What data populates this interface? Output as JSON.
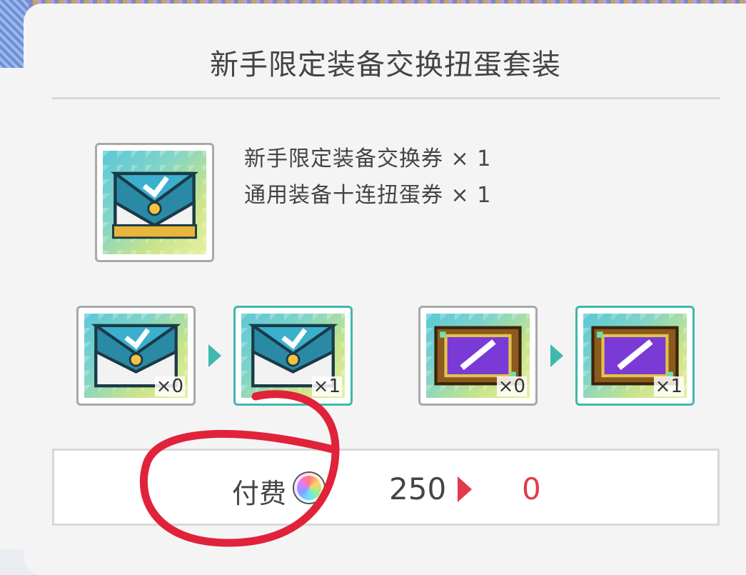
{
  "dialog": {
    "title": "新手限定装备交换扭蛋套装"
  },
  "package": {
    "icon": "teal-envelope-ticket-icon",
    "contents": [
      "新手限定装备交换券 × 1",
      "通用装备十连扭蛋券 × 1"
    ]
  },
  "exchange": [
    {
      "icon": "teal-envelope-ticket-icon",
      "from_count": "×0",
      "to_count": "×1"
    },
    {
      "icon": "purple-sword-ticket-icon",
      "from_count": "×0",
      "to_count": "×1"
    }
  ],
  "cost": {
    "label": "付费",
    "currency_icon": "rainbow-gem-icon",
    "current": "250",
    "after": "0",
    "after_color": "#e23a4a"
  },
  "colors": {
    "accent": "#3fb8ae",
    "annotation": "#e0233a"
  }
}
